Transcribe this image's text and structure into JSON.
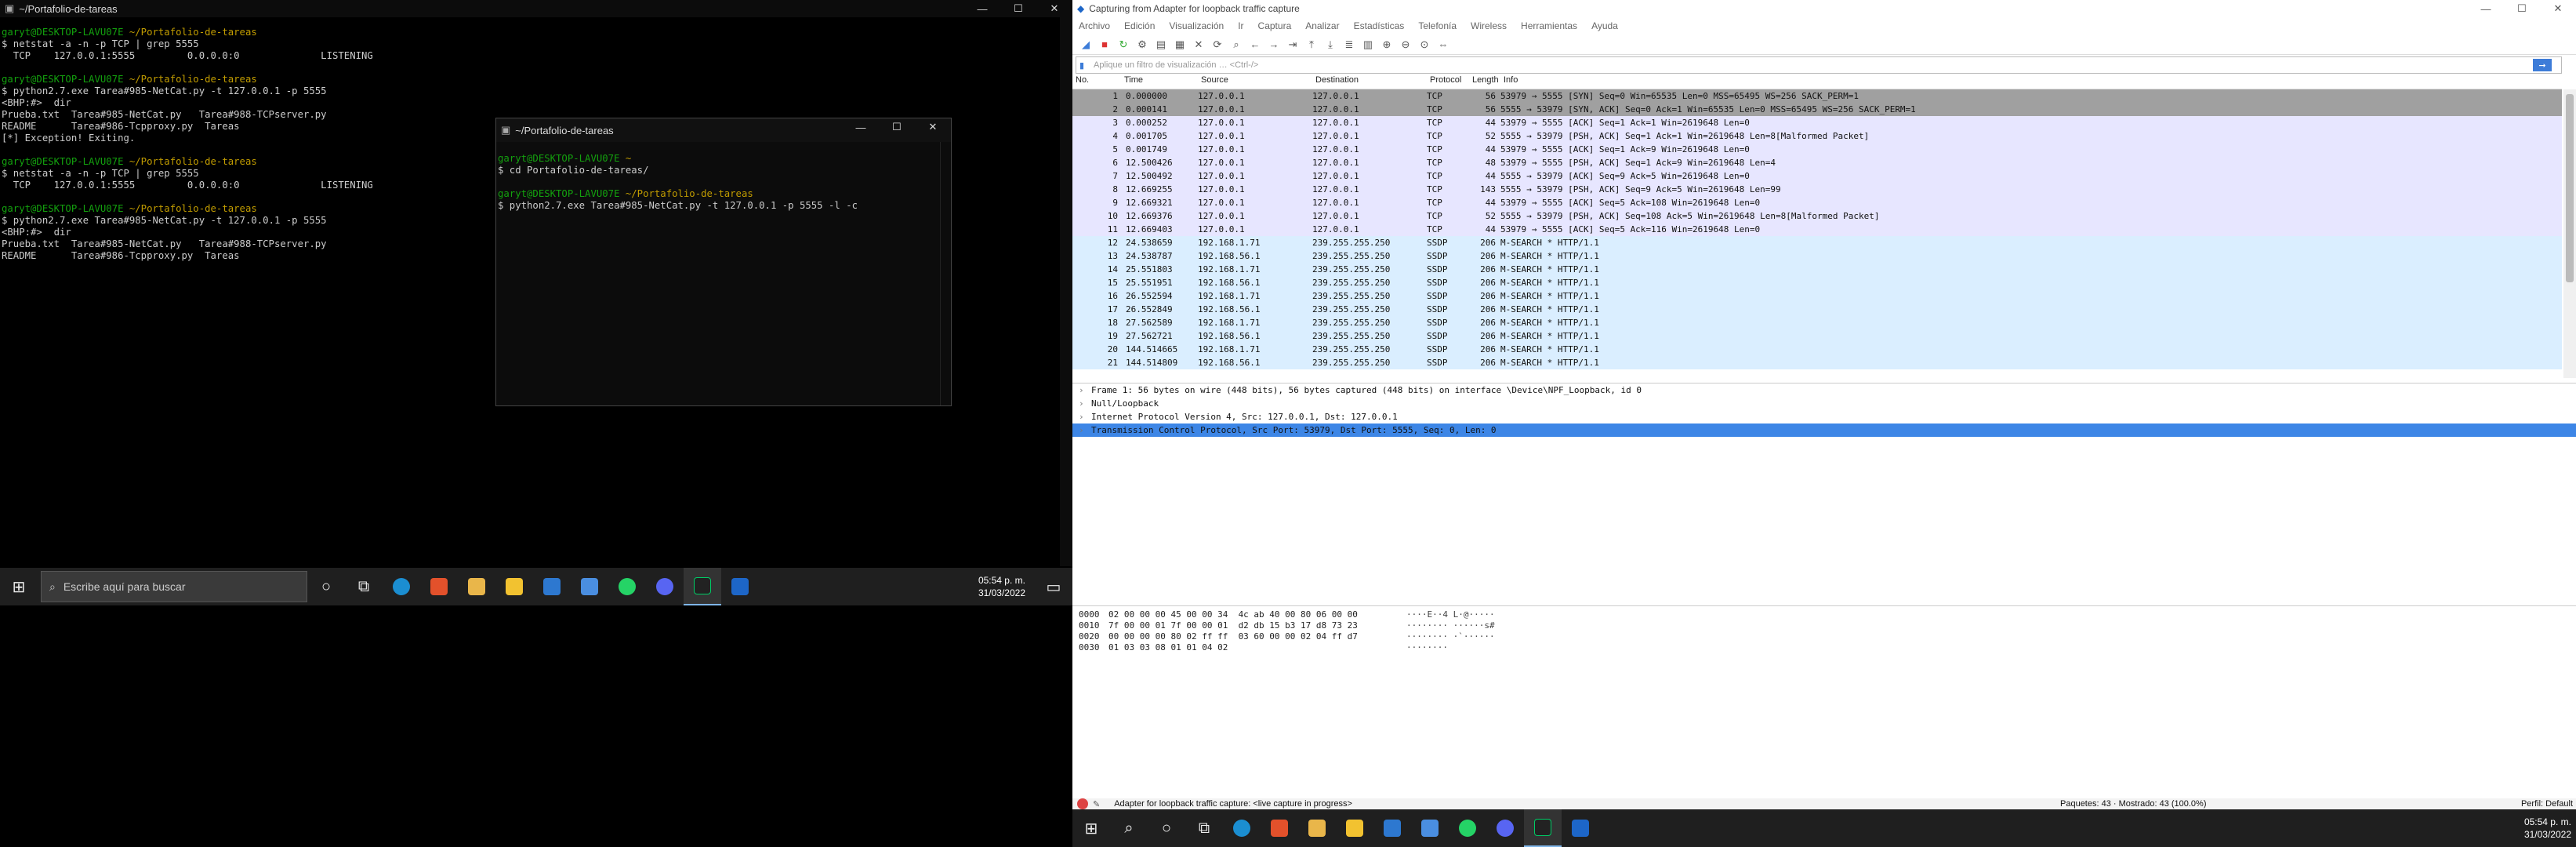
{
  "left_terminal": {
    "title": "~/Portafolio-de-tareas",
    "lines": [
      [
        {
          "t": "garyt@DESKTOP-LAVU07E ",
          "c": "g"
        },
        {
          "t": "~/Portafolio-de-tareas",
          "c": "y"
        }
      ],
      [
        {
          "t": "$ netstat -a -n -p TCP | grep 5555",
          "c": ""
        }
      ],
      [
        {
          "t": "  TCP    127.0.0.1:5555         0.0.0.0:0              LISTENING",
          "c": ""
        }
      ],
      [
        {
          "t": "",
          "c": ""
        }
      ],
      [
        {
          "t": "garyt@DESKTOP-LAVU07E ",
          "c": "g"
        },
        {
          "t": "~/Portafolio-de-tareas",
          "c": "y"
        }
      ],
      [
        {
          "t": "$ python2.7.exe Tarea#985-NetCat.py -t 127.0.0.1 -p 5555",
          "c": ""
        }
      ],
      [
        {
          "t": "<BHP:#>  dir",
          "c": ""
        }
      ],
      [
        {
          "t": "Prueba.txt  Tarea#985-NetCat.py   Tarea#988-TCPserver.py",
          "c": ""
        }
      ],
      [
        {
          "t": "README      Tarea#986-Tcpproxy.py  Tareas",
          "c": ""
        }
      ],
      [
        {
          "t": "[*] Exception! Exiting.",
          "c": ""
        }
      ],
      [
        {
          "t": "",
          "c": ""
        }
      ],
      [
        {
          "t": "garyt@DESKTOP-LAVU07E ",
          "c": "g"
        },
        {
          "t": "~/Portafolio-de-tareas",
          "c": "y"
        }
      ],
      [
        {
          "t": "$ netstat -a -n -p TCP | grep 5555",
          "c": ""
        }
      ],
      [
        {
          "t": "  TCP    127.0.0.1:5555         0.0.0.0:0              LISTENING",
          "c": ""
        }
      ],
      [
        {
          "t": "",
          "c": ""
        }
      ],
      [
        {
          "t": "garyt@DESKTOP-LAVU07E ",
          "c": "g"
        },
        {
          "t": "~/Portafolio-de-tareas",
          "c": "y"
        }
      ],
      [
        {
          "t": "$ python2.7.exe Tarea#985-NetCat.py -t 127.0.0.1 -p 5555",
          "c": ""
        }
      ],
      [
        {
          "t": "<BHP:#>  dir",
          "c": ""
        }
      ],
      [
        {
          "t": "Prueba.txt  Tarea#985-NetCat.py   Tarea#988-TCPserver.py",
          "c": ""
        }
      ],
      [
        {
          "t": "README      Tarea#986-Tcpproxy.py  Tareas",
          "c": ""
        }
      ]
    ]
  },
  "second_terminal": {
    "title": "~/Portafolio-de-tareas",
    "lines": [
      [
        {
          "t": "garyt@DESKTOP-LAVU07E ",
          "c": "g"
        },
        {
          "t": "~",
          "c": "y"
        }
      ],
      [
        {
          "t": "$ cd Portafolio-de-tareas/",
          "c": ""
        }
      ],
      [
        {
          "t": "",
          "c": ""
        }
      ],
      [
        {
          "t": "garyt@DESKTOP-LAVU07E ",
          "c": "g"
        },
        {
          "t": "~/Portafolio-de-tareas",
          "c": "y"
        }
      ],
      [
        {
          "t": "$ python2.7.exe Tarea#985-NetCat.py -t 127.0.0.1 -p 5555 -l -c",
          "c": ""
        }
      ]
    ]
  },
  "window_buttons": {
    "min": "—",
    "max": "☐",
    "close": "✕"
  },
  "taskbar": {
    "search_placeholder": "Escribe aquí para buscar",
    "time": "05:54 p. m.",
    "date": "31/03/2022"
  },
  "wireshark": {
    "title": "Capturing from Adapter for loopback traffic capture",
    "menu": [
      "Archivo",
      "Edición",
      "Visualización",
      "Ir",
      "Captura",
      "Analizar",
      "Estadísticas",
      "Telefonía",
      "Wireless",
      "Herramientas",
      "Ayuda"
    ],
    "filter_placeholder": "Aplique un filtro de visualización … <Ctrl-/>",
    "columns": {
      "no": "No.",
      "time": "Time",
      "source": "Source",
      "destination": "Destination",
      "protocol": "Protocol",
      "length": "Length",
      "info": "Info"
    },
    "packets": [
      {
        "no": "1",
        "time": "0.000000",
        "src": "127.0.0.1",
        "dst": "127.0.0.1",
        "proto": "TCP",
        "len": "56",
        "info": "53979 → 5555 [SYN] Seq=0 Win=65535 Len=0 MSS=65495 WS=256 SACK_PERM=1",
        "bg": "#a0a0a0"
      },
      {
        "no": "2",
        "time": "0.000141",
        "src": "127.0.0.1",
        "dst": "127.0.0.1",
        "proto": "TCP",
        "len": "56",
        "info": "5555 → 53979 [SYN, ACK] Seq=0 Ack=1 Win=65535 Len=0 MSS=65495 WS=256 SACK_PERM=1",
        "bg": "#a0a0a0"
      },
      {
        "no": "3",
        "time": "0.000252",
        "src": "127.0.0.1",
        "dst": "127.0.0.1",
        "proto": "TCP",
        "len": "44",
        "info": "53979 → 5555 [ACK] Seq=1 Ack=1 Win=2619648 Len=0",
        "bg": "#e7e6ff"
      },
      {
        "no": "4",
        "time": "0.001705",
        "src": "127.0.0.1",
        "dst": "127.0.0.1",
        "proto": "TCP",
        "len": "52",
        "info": "5555 → 53979 [PSH, ACK] Seq=1 Ack=1 Win=2619648 Len=8[Malformed Packet]",
        "bg": "#e7e6ff"
      },
      {
        "no": "5",
        "time": "0.001749",
        "src": "127.0.0.1",
        "dst": "127.0.0.1",
        "proto": "TCP",
        "len": "44",
        "info": "53979 → 5555 [ACK] Seq=1 Ack=9 Win=2619648 Len=0",
        "bg": "#e7e6ff"
      },
      {
        "no": "6",
        "time": "12.500426",
        "src": "127.0.0.1",
        "dst": "127.0.0.1",
        "proto": "TCP",
        "len": "48",
        "info": "53979 → 5555 [PSH, ACK] Seq=1 Ack=9 Win=2619648 Len=4",
        "bg": "#e7e6ff"
      },
      {
        "no": "7",
        "time": "12.500492",
        "src": "127.0.0.1",
        "dst": "127.0.0.1",
        "proto": "TCP",
        "len": "44",
        "info": "5555 → 53979 [ACK] Seq=9 Ack=5 Win=2619648 Len=0",
        "bg": "#e7e6ff"
      },
      {
        "no": "8",
        "time": "12.669255",
        "src": "127.0.0.1",
        "dst": "127.0.0.1",
        "proto": "TCP",
        "len": "143",
        "info": "5555 → 53979 [PSH, ACK] Seq=9 Ack=5 Win=2619648 Len=99",
        "bg": "#e7e6ff"
      },
      {
        "no": "9",
        "time": "12.669321",
        "src": "127.0.0.1",
        "dst": "127.0.0.1",
        "proto": "TCP",
        "len": "44",
        "info": "53979 → 5555 [ACK] Seq=5 Ack=108 Win=2619648 Len=0",
        "bg": "#e7e6ff"
      },
      {
        "no": "10",
        "time": "12.669376",
        "src": "127.0.0.1",
        "dst": "127.0.0.1",
        "proto": "TCP",
        "len": "52",
        "info": "5555 → 53979 [PSH, ACK] Seq=108 Ack=5 Win=2619648 Len=8[Malformed Packet]",
        "bg": "#e7e6ff"
      },
      {
        "no": "11",
        "time": "12.669403",
        "src": "127.0.0.1",
        "dst": "127.0.0.1",
        "proto": "TCP",
        "len": "44",
        "info": "53979 → 5555 [ACK] Seq=5 Ack=116 Win=2619648 Len=0",
        "bg": "#e7e6ff"
      },
      {
        "no": "12",
        "time": "24.538659",
        "src": "192.168.1.71",
        "dst": "239.255.255.250",
        "proto": "SSDP",
        "len": "206",
        "info": "M-SEARCH * HTTP/1.1",
        "bg": "#daeeff"
      },
      {
        "no": "13",
        "time": "24.538787",
        "src": "192.168.56.1",
        "dst": "239.255.255.250",
        "proto": "SSDP",
        "len": "206",
        "info": "M-SEARCH * HTTP/1.1",
        "bg": "#daeeff"
      },
      {
        "no": "14",
        "time": "25.551803",
        "src": "192.168.1.71",
        "dst": "239.255.255.250",
        "proto": "SSDP",
        "len": "206",
        "info": "M-SEARCH * HTTP/1.1",
        "bg": "#daeeff"
      },
      {
        "no": "15",
        "time": "25.551951",
        "src": "192.168.56.1",
        "dst": "239.255.255.250",
        "proto": "SSDP",
        "len": "206",
        "info": "M-SEARCH * HTTP/1.1",
        "bg": "#daeeff"
      },
      {
        "no": "16",
        "time": "26.552594",
        "src": "192.168.1.71",
        "dst": "239.255.255.250",
        "proto": "SSDP",
        "len": "206",
        "info": "M-SEARCH * HTTP/1.1",
        "bg": "#daeeff"
      },
      {
        "no": "17",
        "time": "26.552849",
        "src": "192.168.56.1",
        "dst": "239.255.255.250",
        "proto": "SSDP",
        "len": "206",
        "info": "M-SEARCH * HTTP/1.1",
        "bg": "#daeeff"
      },
      {
        "no": "18",
        "time": "27.562589",
        "src": "192.168.1.71",
        "dst": "239.255.255.250",
        "proto": "SSDP",
        "len": "206",
        "info": "M-SEARCH * HTTP/1.1",
        "bg": "#daeeff"
      },
      {
        "no": "19",
        "time": "27.562721",
        "src": "192.168.56.1",
        "dst": "239.255.255.250",
        "proto": "SSDP",
        "len": "206",
        "info": "M-SEARCH * HTTP/1.1",
        "bg": "#daeeff"
      },
      {
        "no": "20",
        "time": "144.514665",
        "src": "192.168.1.71",
        "dst": "239.255.255.250",
        "proto": "SSDP",
        "len": "206",
        "info": "M-SEARCH * HTTP/1.1",
        "bg": "#daeeff"
      },
      {
        "no": "21",
        "time": "144.514809",
        "src": "192.168.56.1",
        "dst": "239.255.255.250",
        "proto": "SSDP",
        "len": "206",
        "info": "M-SEARCH * HTTP/1.1",
        "bg": "#daeeff"
      }
    ],
    "details": [
      {
        "text": "Frame 1: 56 bytes on wire (448 bits), 56 bytes captured (448 bits) on interface \\Device\\NPF_Loopback, id 0",
        "sel": false
      },
      {
        "text": "Null/Loopback",
        "sel": false
      },
      {
        "text": "Internet Protocol Version 4, Src: 127.0.0.1, Dst: 127.0.0.1",
        "sel": false
      },
      {
        "text": "Transmission Control Protocol, Src Port: 53979, Dst Port: 5555, Seq: 0, Len: 0",
        "sel": true
      }
    ],
    "bytes": [
      {
        "off": "0000",
        "hex": "02 00 00 00 45 00 00 34  4c ab 40 00 80 06 00 00",
        "asc": "····E··4 L·@·····"
      },
      {
        "off": "0010",
        "hex": "7f 00 00 01 7f 00 00 01  d2 db 15 b3 17 d8 73 23",
        "asc": "········ ······s#"
      },
      {
        "off": "0020",
        "hex": "00 00 00 00 80 02 ff ff  03 60 00 00 02 04 ff d7",
        "asc": "········ ·`······"
      },
      {
        "off": "0030",
        "hex": "01 03 03 08 01 01 04 02",
        "asc": "········"
      }
    ],
    "status_left": "Adapter for loopback traffic capture: <live capture in progress>",
    "status_packets": "Paquetes: 43 · Mostrado: 43 (100.0%)",
    "status_profile": "Perfil: Default"
  }
}
